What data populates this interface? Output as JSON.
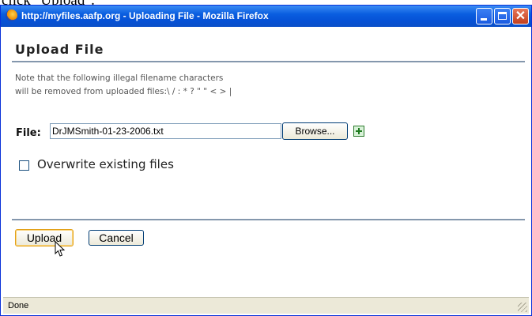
{
  "top_caption": "click \"Upload\".",
  "window": {
    "title": "http://myfiles.aafp.org - Uploading File - Mozilla Firefox"
  },
  "page": {
    "title": "Upload File",
    "note_line1": "Note that the following illegal filename characters",
    "note_line2": "will be removed from uploaded files:\\ / : * ? \" \" < > |",
    "file_label": "File:",
    "file_value": "DrJMSmith-01-23-2006.txt",
    "browse_label": "Browse...",
    "overwrite_label": "Overwrite existing files",
    "overwrite_checked": false,
    "upload_label": "Upload",
    "cancel_label": "Cancel"
  },
  "status": {
    "text": "Done"
  },
  "colors": {
    "titlebar": "#0a5ee0",
    "window_border": "#0831d9",
    "close_button": "#c3401d",
    "rule": "#8497ad",
    "focus_button": "#e3a21a"
  },
  "icons": [
    "firefox-icon",
    "minimize-icon",
    "maximize-icon",
    "close-icon",
    "add-file-icon",
    "mouse-cursor-icon",
    "resize-grip-icon"
  ]
}
